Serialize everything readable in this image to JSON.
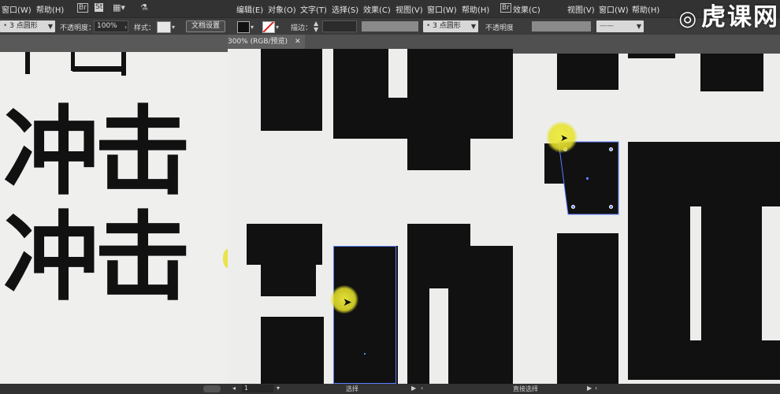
{
  "left_panel": {
    "menu": {
      "window": "窗口(W)",
      "help": "帮助(H)"
    },
    "menu_icons": [
      "bridge-icon",
      "stock-icon",
      "workspace-grid-icon",
      "gpu-icon"
    ],
    "stroke_preset": "3 点圆形",
    "opacity_label": "不透明度：",
    "opacity_value": "100%",
    "style_label": "样式：",
    "doc_settings_button": "文档设置",
    "artwork_text": [
      "冲击",
      "冲击"
    ]
  },
  "middle_panel": {
    "menu": {
      "edit": "编辑(E)",
      "object": "对象(O)",
      "type": "文字(T)",
      "select": "选择(S)",
      "effect": "效果(C)",
      "view": "视图(V)",
      "window": "窗口(W)",
      "help": "帮助(H)"
    },
    "stroke_label": "描边：",
    "stroke_preset": "3 点圆形",
    "opacity_label": "不透明度",
    "document_tab": "300% (RGB/预览)",
    "status_page": "1",
    "status_tool": "选择"
  },
  "right_panel": {
    "menu": {
      "effect": "效果(C)",
      "view": "视图(V)",
      "window": "窗口(W)",
      "help": "帮助(H)"
    },
    "watermark": "虎课网",
    "status_tool": "直接选择"
  },
  "colors": {
    "menubar": "#323232",
    "controlbar": "#3c3c3c",
    "canvas": "#ededeb",
    "artwork": "#111111",
    "selection": "#5a7cff",
    "cursor_highlight": "#f0ec3c"
  }
}
